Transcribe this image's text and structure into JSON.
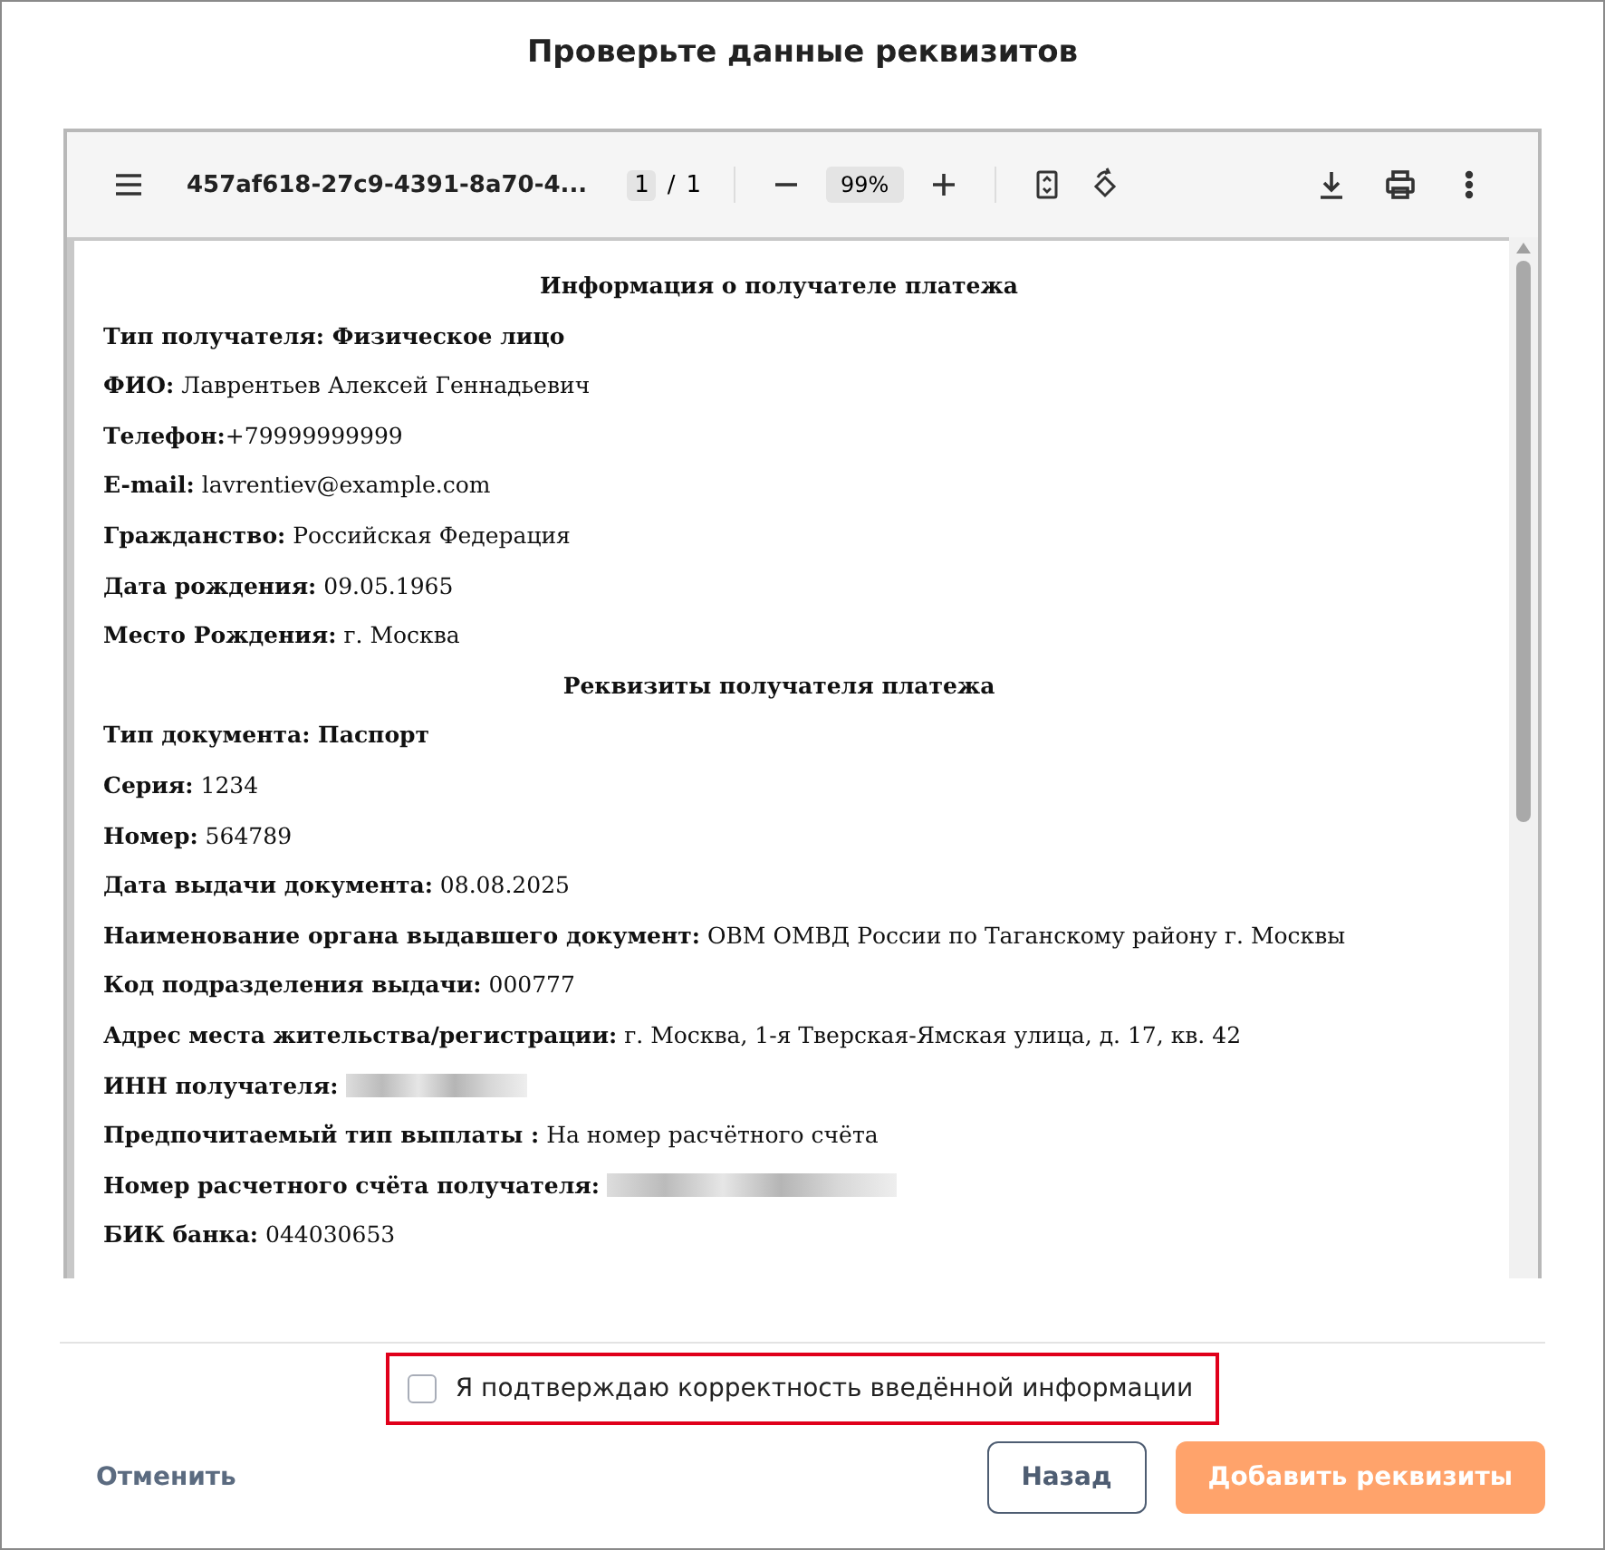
{
  "dialog": {
    "title": "Проверьте данные реквизитов"
  },
  "viewer": {
    "file_name": "457af618-27c9-4391-8a70-4...",
    "page": "1",
    "page_separator": "/",
    "page_count": "1",
    "zoom": "99%"
  },
  "document": {
    "lines": [
      {
        "kind": "heading",
        "text": "Информация о получателе платежа"
      },
      {
        "kind": "bold",
        "text": "Тип получателя: Физическое лицо"
      },
      {
        "kind": "field",
        "text": "**ФИО:** Лаврентьев Алексей Геннадьевич"
      },
      {
        "kind": "field",
        "text": "**Телефон:**+79999999999"
      },
      {
        "kind": "field",
        "text": "**E-mail:** lavrentiev@example.com"
      },
      {
        "kind": "field",
        "text": "**Гражданство:** Российская Федерация"
      },
      {
        "kind": "field",
        "text": "**Дата рождения:** 09.05.1965"
      },
      {
        "kind": "field",
        "text": "**Место Рождения:** г. Москва"
      },
      {
        "kind": "heading",
        "text": "Реквизиты получателя платежа"
      },
      {
        "kind": "bold",
        "text": "Тип документа: Паспорт"
      },
      {
        "kind": "field",
        "text": "**Серия:** 1234"
      },
      {
        "kind": "field",
        "text": "**Номер:** 564789"
      },
      {
        "kind": "field",
        "text": "**Дата выдачи документа:** 08.08.2025"
      },
      {
        "kind": "field",
        "text": "**Наименование органа выдавшего документ:** ОВМ ОМВД России по Таганскому району г. Москвы"
      },
      {
        "kind": "field",
        "text": "**Код подразделения выдачи:** 000777"
      },
      {
        "kind": "field",
        "text": "**Адрес места жительства/регистрации:** г. Москва, 1-я Тверская-Ямская улица, д. 17, кв. 42"
      },
      {
        "kind": "redacted",
        "text": "ИНН получателя:"
      },
      {
        "kind": "field",
        "text": "**Предпочитаемый тип выплаты :** На номер расчётного счёта"
      },
      {
        "kind": "redacted",
        "text": "Номер расчетного счёта получателя:"
      },
      {
        "kind": "field",
        "text": "**БИК банка:** 044030653"
      }
    ]
  },
  "confirm": {
    "label": "Я подтверждаю корректность введённой информации",
    "checked": false,
    "error": true
  },
  "buttons": {
    "cancel": "Отменить",
    "back": "Назад",
    "submit": {
      "label": "Добавить реквизиты",
      "disabled": true
    }
  }
}
